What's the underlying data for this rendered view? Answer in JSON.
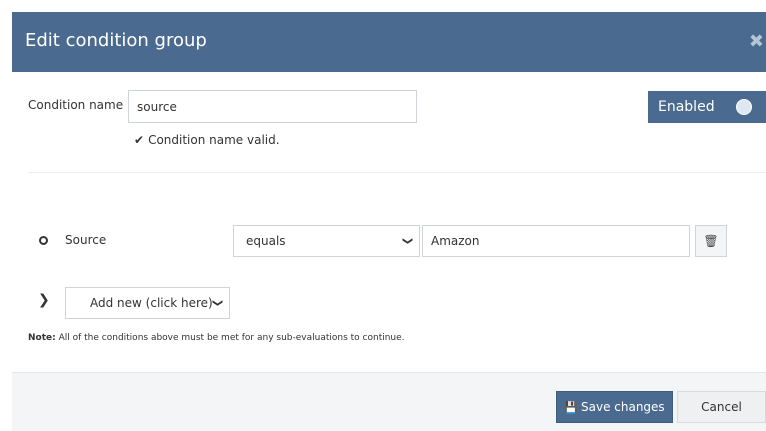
{
  "modal": {
    "title": "Edit condition group",
    "close_icon": "close-icon"
  },
  "condition": {
    "name_label": "Condition name",
    "name_value": "source",
    "valid_message": "Condition name valid."
  },
  "toggle": {
    "label": "Enabled",
    "state": "on"
  },
  "rule": {
    "field": "Source",
    "operator": "equals",
    "value": "Amazon"
  },
  "add_new": {
    "label": "Add new (click here)"
  },
  "note": {
    "prefix": "Note:",
    "text": " All of the conditions above must be met for any sub-evaluations to continue."
  },
  "footer": {
    "save_label": "Save changes",
    "cancel_label": "Cancel"
  },
  "colors": {
    "header_bg": "#4a6b8f",
    "primary": "#4a6b8f"
  }
}
